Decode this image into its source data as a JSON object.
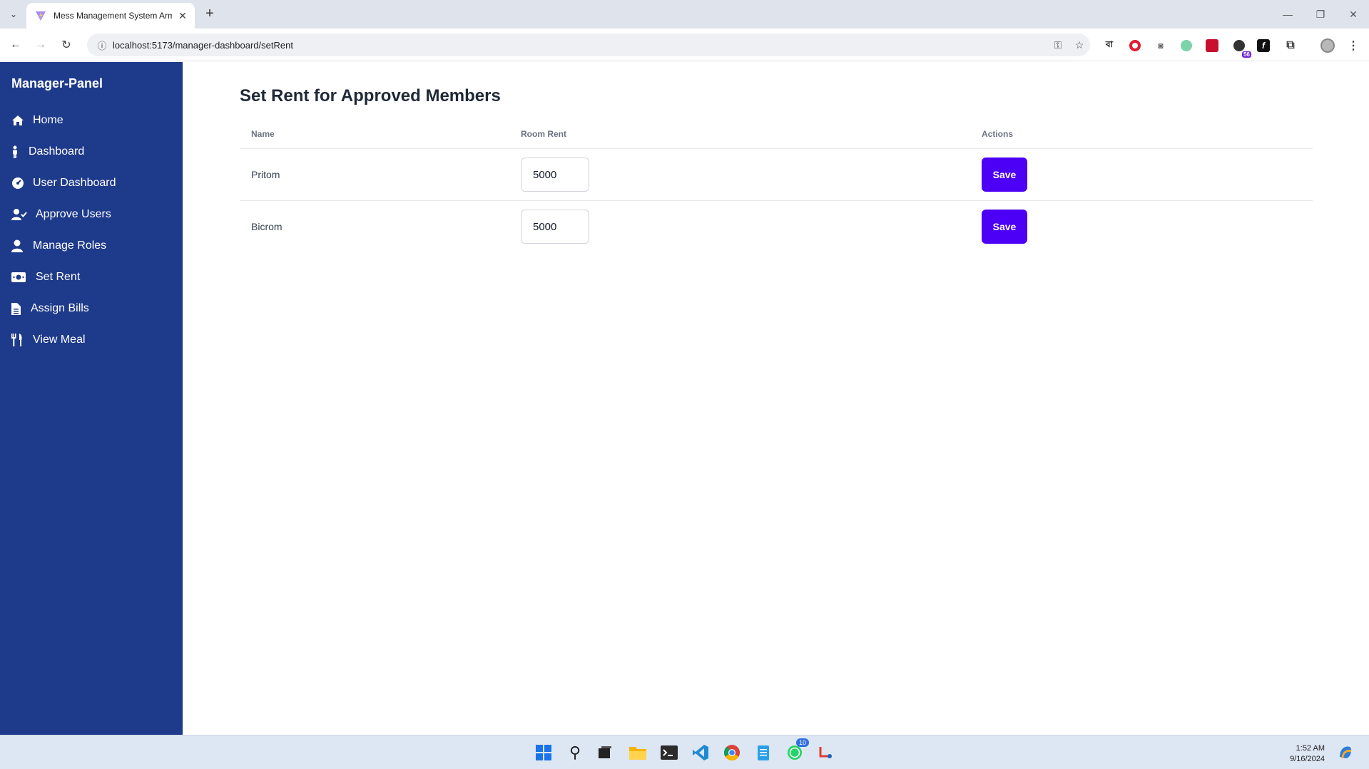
{
  "browser": {
    "tab_title": "Mess Management System Arm",
    "url": "localhost:5173/manager-dashboard/setRent",
    "extension_badge": "56"
  },
  "sidebar": {
    "brand": "Manager-Panel",
    "items": [
      {
        "label": "Home",
        "icon": "home-icon"
      },
      {
        "label": "Dashboard",
        "icon": "person-icon"
      },
      {
        "label": "User Dashboard",
        "icon": "gauge-icon"
      },
      {
        "label": "Approve Users",
        "icon": "user-check-icon"
      },
      {
        "label": "Manage Roles",
        "icon": "user-icon"
      },
      {
        "label": "Set Rent",
        "icon": "money-icon"
      },
      {
        "label": "Assign Bills",
        "icon": "file-icon"
      },
      {
        "label": "View Meal",
        "icon": "utensils-icon"
      }
    ]
  },
  "main": {
    "title": "Set Rent for Approved Members",
    "columns": [
      "Name",
      "Room Rent",
      "Actions"
    ],
    "rows": [
      {
        "name": "Pritom",
        "rent": "5000",
        "action": "Save"
      },
      {
        "name": "Bicrom",
        "rent": "5000",
        "action": "Save"
      }
    ]
  },
  "taskbar": {
    "whatsapp_badge": "10",
    "time": "1:52 AM",
    "date": "9/16/2024"
  },
  "colors": {
    "sidebar_bg": "#1e3a8a",
    "save_button": "#4c00f5"
  }
}
